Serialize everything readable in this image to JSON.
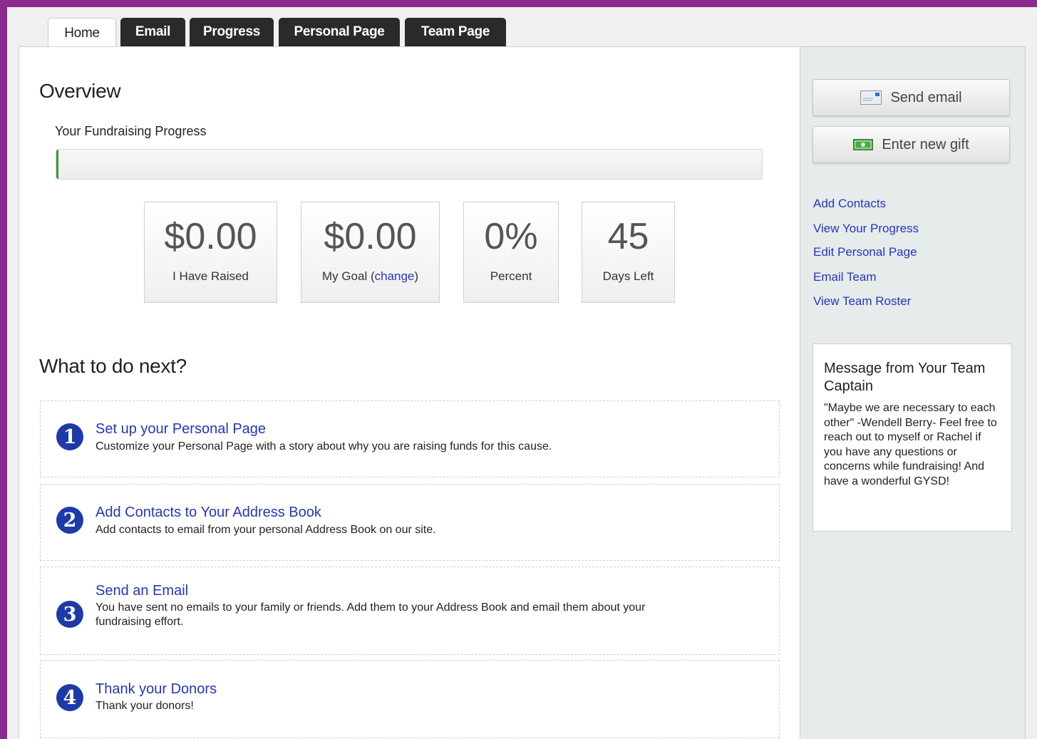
{
  "tabs": [
    {
      "label": "Home",
      "active": true
    },
    {
      "label": "Email"
    },
    {
      "label": "Progress"
    },
    {
      "label": "Personal Page"
    },
    {
      "label": "Team Page"
    }
  ],
  "overview": {
    "title": "Overview",
    "progress_label": "Your Fundraising Progress",
    "progress_percent": 0,
    "stats": {
      "raised": {
        "value": "$0.00",
        "label": "I Have Raised"
      },
      "goal": {
        "value": "$0.00",
        "label_prefix": "My Goal (",
        "change_link": "change",
        "label_suffix": ")"
      },
      "percent": {
        "value": "0%",
        "label": "Percent"
      },
      "days": {
        "value": "45",
        "label": "Days Left"
      }
    }
  },
  "next": {
    "title": "What to do next?",
    "steps": [
      {
        "num": "1",
        "title": "Set up your Personal Page",
        "desc": "Customize your Personal Page with a story about why you are raising funds for this cause."
      },
      {
        "num": "2",
        "title": "Add Contacts to Your Address Book",
        "desc": "Add contacts to email from your personal Address Book on our site."
      },
      {
        "num": "3",
        "title": "Send an Email",
        "desc": "You have sent no emails to your family or friends. Add them to your Address Book and email them about your fundraising effort."
      },
      {
        "num": "4",
        "title": "Thank your Donors",
        "desc": "Thank your donors!"
      }
    ]
  },
  "sidebar": {
    "send_email": "Send email",
    "enter_gift": "Enter new gift",
    "links": [
      "Add Contacts",
      "View Your Progress",
      "Edit Personal Page",
      "Email Team",
      "View Team Roster"
    ],
    "message": {
      "title": "Message from Your Team Captain",
      "body": "\"Maybe we are necessary to each other\" -Wendell Berry- Feel free to reach out to myself or Rachel if you have any questions or concerns while fundraising! And have a wonderful GYSD!"
    }
  },
  "colors": {
    "page_border": "#8b2a8f",
    "link": "#2636b8",
    "step_number": "#1d3aa8",
    "tab_dark": "#2a2a2a",
    "progress_fill": "#3a9a3a"
  }
}
